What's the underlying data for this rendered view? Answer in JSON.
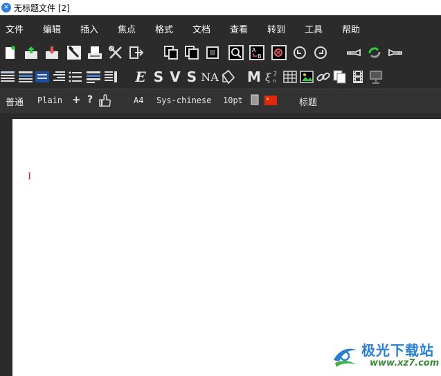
{
  "window": {
    "title": "无标题文件 [2]",
    "app_icon": "app-logo-icon"
  },
  "menu": [
    {
      "label": "文件"
    },
    {
      "label": "编辑"
    },
    {
      "label": "插入"
    },
    {
      "label": "焦点"
    },
    {
      "label": "格式"
    },
    {
      "label": "文档"
    },
    {
      "label": "查看"
    },
    {
      "label": "转到"
    },
    {
      "label": "工具"
    },
    {
      "label": "帮助"
    }
  ],
  "toolbar_row2_glyphs": {
    "emphasis": "E",
    "strong": "S",
    "verbatim": "V",
    "sans": "S",
    "name": "NA",
    "math": "M",
    "subscript": "ξ"
  },
  "status": {
    "layout": "普通",
    "font_style": "Plain",
    "plus": "+",
    "question": "?",
    "paper": "A4",
    "language": "Sys-chinese",
    "font_size": "10pt",
    "heading": "标题"
  },
  "document": {
    "cursor_glyph": "I"
  },
  "watermark": {
    "name": "极光下载站",
    "url": "www.xz7.com"
  },
  "colors": {
    "background": "#2b2b2b",
    "page": "#ffffff",
    "cursor": "#cc2020",
    "accent": "#2f7fd8"
  }
}
